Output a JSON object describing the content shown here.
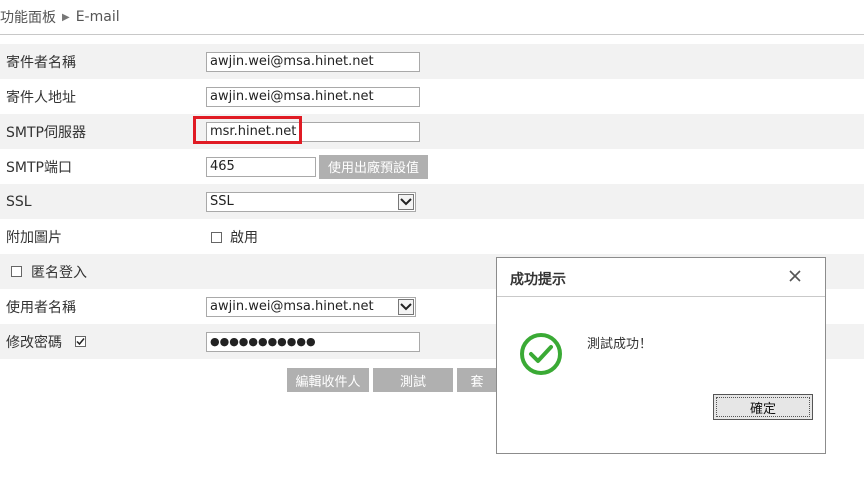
{
  "breadcrumb": {
    "root": "功能面板",
    "current": "E-mail"
  },
  "form": {
    "sender_name_label": "寄件者名稱",
    "sender_name_value": "awjin.wei@msa.hinet.net",
    "sender_address_label": "寄件人地址",
    "sender_address_value": "awjin.wei@msa.hinet.net",
    "smtp_server_label": "SMTP伺服器",
    "smtp_server_value": "msr.hinet.net",
    "smtp_port_label": "SMTP端口",
    "smtp_port_value": "465",
    "default_button": "使用出廠預設值",
    "ssl_label": "SSL",
    "ssl_value": "SSL",
    "attach_image_label": "附加圖片",
    "attach_image_option": "啟用",
    "attach_image_checked": false,
    "anonymous_login_label": "匿名登入",
    "anonymous_login_checked": false,
    "username_label": "使用者名稱",
    "username_value": "awjin.wei@msa.hinet.net",
    "change_password_label": "修改密碼",
    "change_password_checked": true,
    "password_masked": "●●●●●●●●●●●"
  },
  "actions": {
    "edit_recipients": "編輯收件人",
    "test": "測試",
    "save_partial": "套"
  },
  "dialog": {
    "title": "成功提示",
    "message": "測試成功！",
    "ok": "確定",
    "success_color": "#3aaa35"
  },
  "icons": {
    "close": "close-icon",
    "success": "check-circle-icon",
    "dropdown": "chevron-down-icon",
    "breadcrumb_separator": "triangle-right-icon"
  }
}
